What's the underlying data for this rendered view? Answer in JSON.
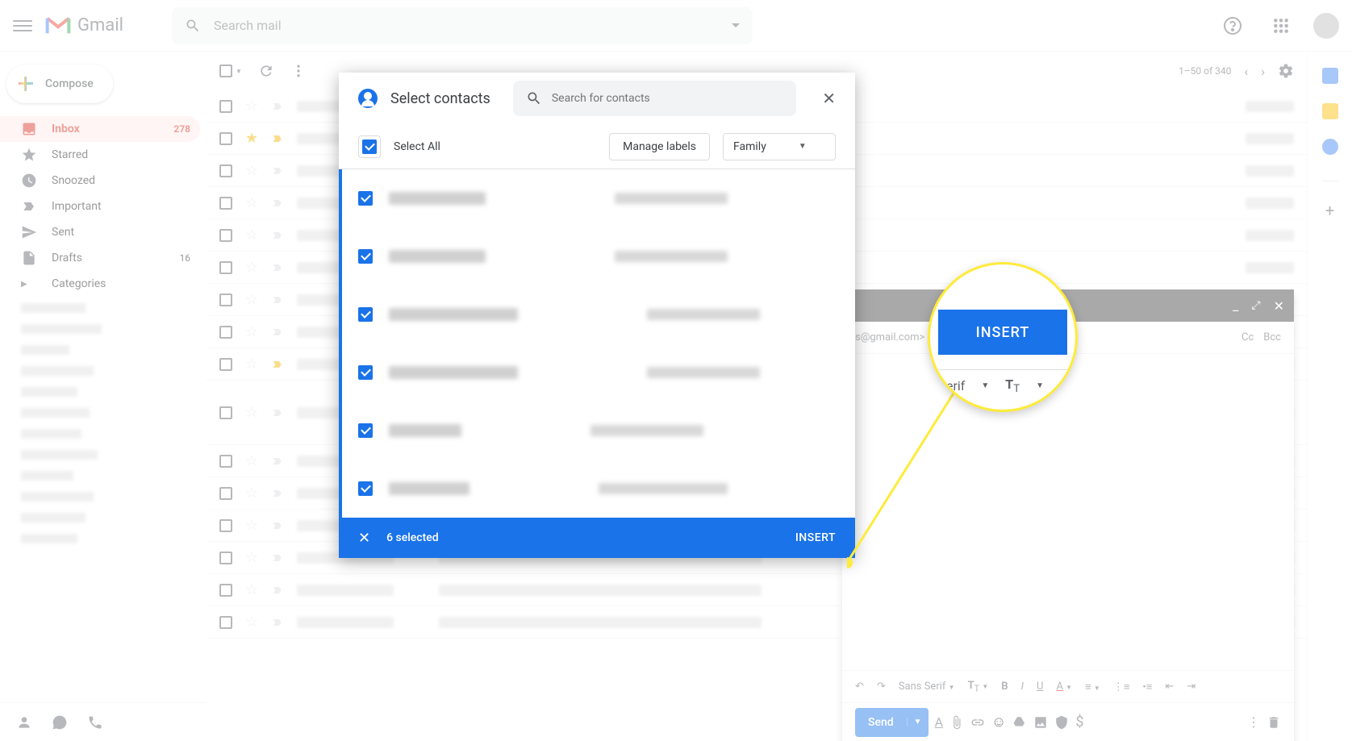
{
  "header": {
    "app_name": "Gmail",
    "search_placeholder": "Search mail"
  },
  "sidebar": {
    "compose": "Compose",
    "items": [
      {
        "label": "Inbox",
        "count": "278",
        "active": true
      },
      {
        "label": "Starred"
      },
      {
        "label": "Snoozed"
      },
      {
        "label": "Important"
      },
      {
        "label": "Sent"
      },
      {
        "label": "Drafts",
        "count": "16"
      },
      {
        "label": "Categories"
      }
    ]
  },
  "toolbar": {
    "pagination": "1–50 of 340"
  },
  "compose_window": {
    "to_suffix": "s@gmail.com>",
    "cc": "Cc",
    "bcc": "Bcc",
    "send": "Send",
    "font": "Sans Serif"
  },
  "modal": {
    "title": "Select contacts",
    "search_placeholder": "Search for contacts",
    "select_all": "Select All",
    "manage_labels": "Manage labels",
    "label_group": "Family",
    "selected_text": "6 selected",
    "insert": "INSERT"
  },
  "callout": {
    "insert": "INSERT",
    "font_fragment": "erif"
  }
}
